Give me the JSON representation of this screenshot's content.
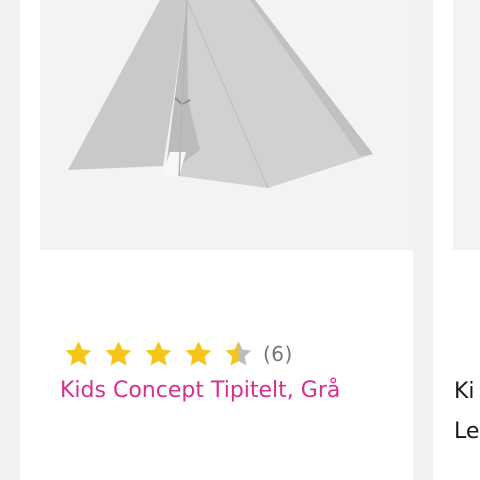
{
  "product": {
    "title": "Kids Concept Tipitelt, Grå",
    "rating": 4.5,
    "rating_max": 5,
    "review_count_label": "(6)",
    "image_icon": "tipi-tent-image"
  },
  "next_product": {
    "title_line1": "Ki",
    "title_line2": "Le"
  },
  "colors": {
    "star_fill": "#f5c518",
    "star_empty": "#bdbdbd",
    "title_link": "#d6308f"
  }
}
